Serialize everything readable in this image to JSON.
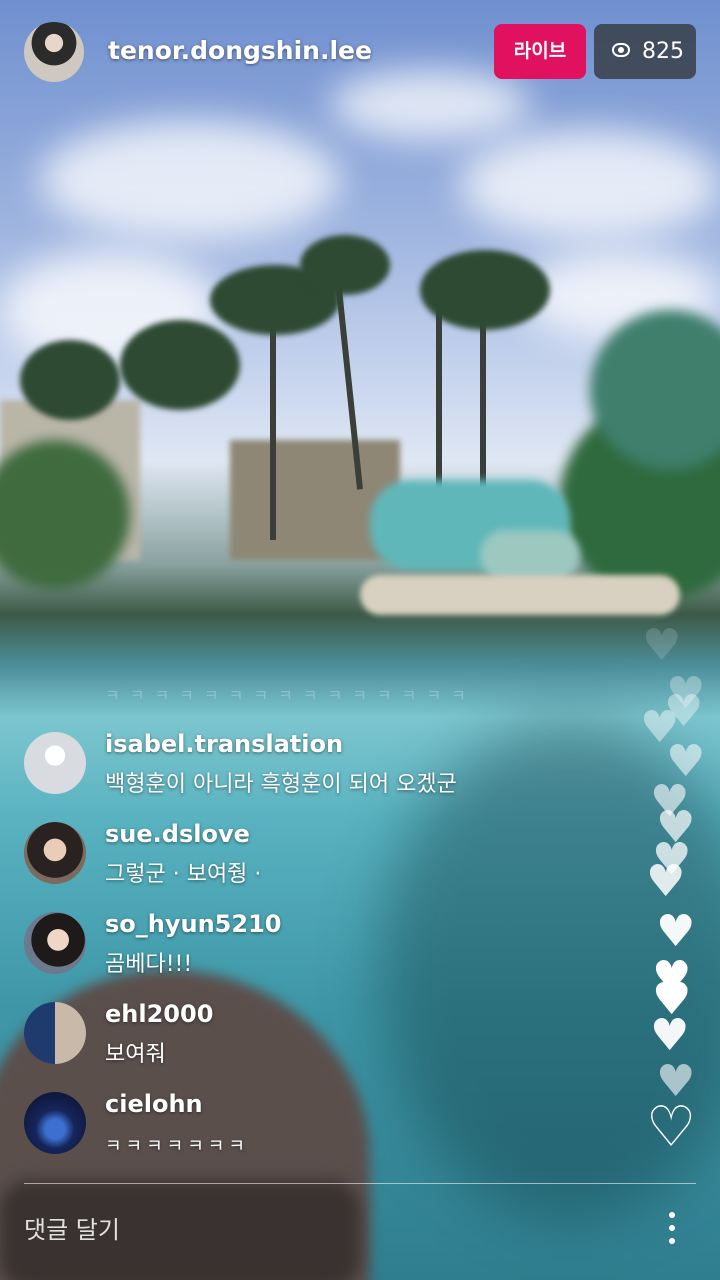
{
  "host": {
    "username": "tenor.dongshin.lee",
    "avatar_icon": "host-avatar"
  },
  "live_badge": "라이브",
  "viewers": {
    "icon": "eye-icon",
    "count": "825"
  },
  "faded_text": "ㅋㅋㅋㅋㅋㅋㅋㅋㅋㅋㅋㅋㅋㅋㅋ",
  "comments": [
    {
      "username": "isabel.translation",
      "text": "백형훈이 아니라 흑형훈이 되어 오겠군"
    },
    {
      "username": "sue.dslove",
      "text": "그렇군 · 보여줭 ·"
    },
    {
      "username": "so_hyun5210",
      "text": "곰베다!!!"
    },
    {
      "username": "ehl2000",
      "text": "보여줘"
    },
    {
      "username": "cielohn",
      "text": "ㅋㅋㅋㅋㅋㅋㅋ"
    }
  ],
  "like_button_icon": "heart-outline-icon",
  "comment_input_placeholder": "댓글 달기",
  "more_icon": "more-vertical-icon",
  "colors": {
    "live_badge": "#e0115f",
    "viewer_pill": "#373e48"
  }
}
